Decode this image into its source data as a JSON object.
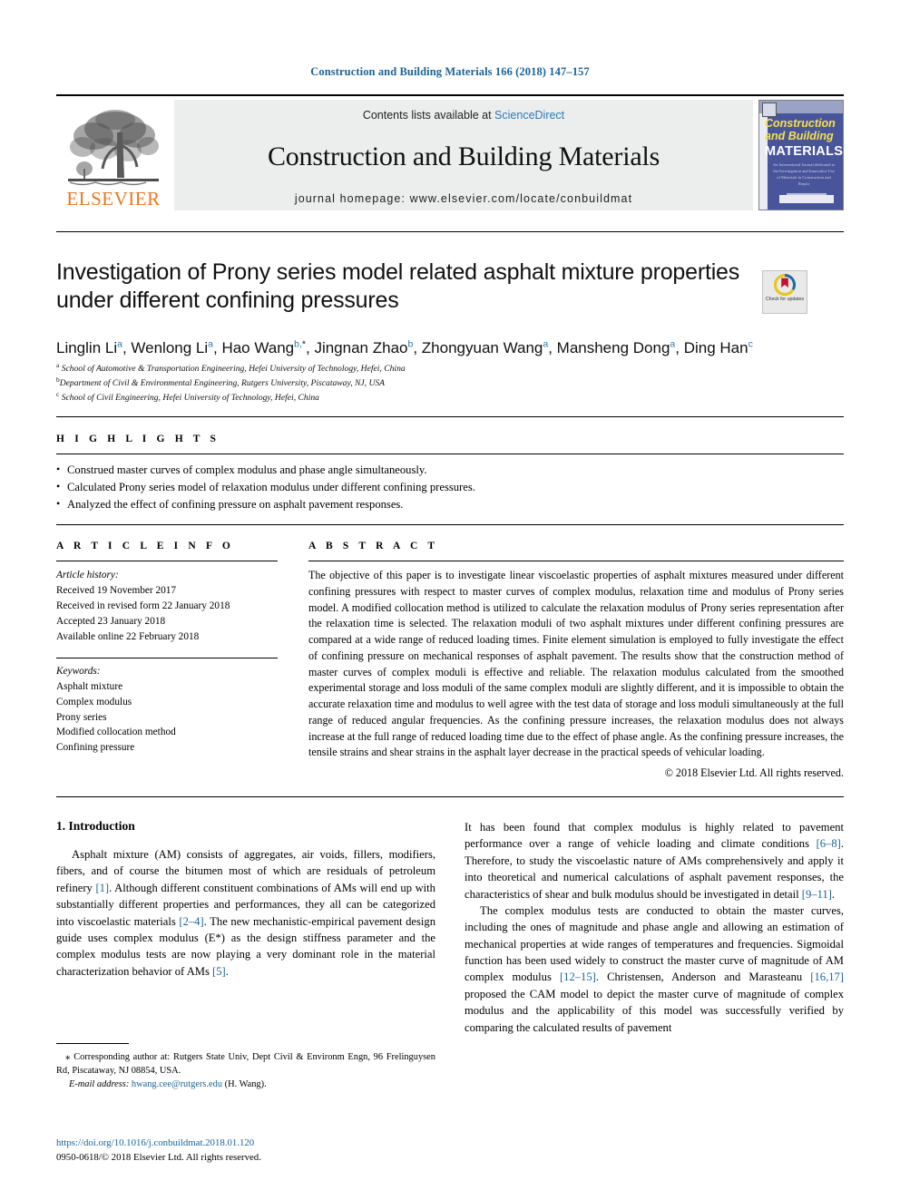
{
  "running_head": "Construction and Building Materials 166 (2018) 147–157",
  "masthead": {
    "contents_prefix": "Contents lists available at ",
    "contents_link": "ScienceDirect",
    "journal_name": "Construction and Building Materials",
    "homepage": "journal homepage: www.elsevier.com/locate/conbuildmat",
    "publisher": "ELSEVIER",
    "cover": {
      "title_line1": "Construction",
      "title_line2": "and Building",
      "title_line3": "MATERIALS",
      "subtitle": "An International Journal dedicated to the Investigation and Innovative Use of Materials in Construction and Repair"
    }
  },
  "article": {
    "title": "Investigation of Prony series model related asphalt mixture properties under different confining pressures",
    "crossmark_label": "Check for updates",
    "authors": [
      {
        "name": "Linglin Li",
        "sup": "a",
        "sep": ", "
      },
      {
        "name": "Wenlong Li",
        "sup": "a",
        "sep": ", "
      },
      {
        "name": "Hao Wang",
        "sup": "b,",
        "star": "*",
        "sep": ", "
      },
      {
        "name": "Jingnan Zhao",
        "sup": "b",
        "sep": ", "
      },
      {
        "name": "Zhongyuan Wang",
        "sup": "a",
        "sep": ", "
      },
      {
        "name": "Mansheng Dong",
        "sup": "a",
        "sep": ", "
      },
      {
        "name": "Ding Han",
        "sup": "c",
        "sep": ""
      }
    ],
    "affiliations": [
      {
        "mark": "a",
        "text": "School of Automotive & Transportation Engineering, Hefei University of Technology, Hefei, China"
      },
      {
        "mark": "b",
        "text": "Department of Civil & Environmental Engineering, Rutgers University, Piscataway, NJ, USA"
      },
      {
        "mark": "c",
        "text": "School of Civil Engineering, Hefei University of Technology, Hefei, China"
      }
    ]
  },
  "highlights": {
    "heading": "H I G H L I G H T S",
    "items": [
      "Construed master curves of complex modulus and phase angle simultaneously.",
      "Calculated Prony series model of relaxation modulus under different confining pressures.",
      "Analyzed the effect of confining pressure on asphalt pavement responses."
    ]
  },
  "article_info": {
    "heading": "A R T I C L E   I N F O",
    "history_label": "Article history:",
    "history": [
      "Received 19 November 2017",
      "Received in revised form 22 January 2018",
      "Accepted 23 January 2018",
      "Available online 22 February 2018"
    ],
    "keywords_label": "Keywords:",
    "keywords": [
      "Asphalt mixture",
      "Complex modulus",
      "Prony series",
      "Modified collocation method",
      "Confining pressure"
    ]
  },
  "abstract": {
    "heading": "A B S T R A C T",
    "text": "The objective of this paper is to investigate linear viscoelastic properties of asphalt mixtures measured under different confining pressures with respect to master curves of complex modulus, relaxation time and modulus of Prony series model. A modified collocation method is utilized to calculate the relaxation modulus of Prony series representation after the relaxation time is selected. The relaxation moduli of two asphalt mixtures under different confining pressures are compared at a wide range of reduced loading times. Finite element simulation is employed to fully investigate the effect of confining pressure on mechanical responses of asphalt pavement. The results show that the construction method of master curves of complex moduli is effective and reliable. The relaxation modulus calculated from the smoothed experimental storage and loss moduli of the same complex moduli are slightly different, and it is impossible to obtain the accurate relaxation time and modulus to well agree with the test data of storage and loss moduli simultaneously at the full range of reduced angular frequencies. As the confining pressure increases, the relaxation modulus does not always increase at the full range of reduced loading time due to the effect of phase angle. As the confining pressure increases, the tensile strains and shear strains in the asphalt layer decrease in the practical speeds of vehicular loading.",
    "copyright": "© 2018 Elsevier Ltd. All rights reserved."
  },
  "body": {
    "section_heading": "1. Introduction",
    "left_paragraph_1_a": "Asphalt mixture (AM) consists of aggregates, air voids, fillers, modifiers, fibers, and of course the bitumen most of which are residuals of petroleum refinery ",
    "left_ref_1": "[1]",
    "left_paragraph_1_b": ". Although different constituent combinations of AMs will end up with substantially different properties and performances, they all can be categorized into viscoelastic materials ",
    "left_ref_2": "[2–4]",
    "left_paragraph_1_c": ". The new mechanistic-empirical pavement design guide uses complex modulus (E*) as the design stiffness parameter and the complex modulus tests are now playing a very dominant role in the material characterization behavior of AMs ",
    "left_ref_3": "[5]",
    "left_paragraph_1_d": ".",
    "right_paragraph_1_a": "It has been found that complex modulus is highly related to pavement performance over a range of vehicle loading and climate conditions ",
    "right_ref_1": "[6–8]",
    "right_paragraph_1_b": ". Therefore, to study the viscoelastic nature of AMs comprehensively and apply it into theoretical and numerical calculations of asphalt pavement responses, the characteristics of shear and bulk modulus should be investigated in detail ",
    "right_ref_2": "[9–11]",
    "right_paragraph_1_c": ".",
    "right_paragraph_2_a": "The complex modulus tests are conducted to obtain the master curves, including the ones of magnitude and phase angle and allowing an estimation of mechanical properties at wide ranges of temperatures and frequencies. Sigmoidal function has been used widely to construct the master curve of magnitude of AM complex modulus ",
    "right_ref_3": "[12–15]",
    "right_paragraph_2_b": ". Christensen, Anderson and Marasteanu ",
    "right_ref_4": "[16,17]",
    "right_paragraph_2_c": " proposed the CAM model to depict the master curve of magnitude of complex modulus and the applicability of this model was successfully verified by comparing the calculated results of pavement"
  },
  "footnote": {
    "star": "⁎",
    "corresponding": " Corresponding author at: Rutgers State Univ, Dept Civil & Environm Engn, 96 Frelinguysen Rd, Piscataway, NJ 08854, USA.",
    "email_label": "E-mail address:",
    "email": "hwang.cee@rutgers.edu",
    "email_owner": "(H. Wang)."
  },
  "doi": {
    "url": "https://doi.org/10.1016/j.conbuildmat.2018.01.120",
    "issn": "0950-0618/© 2018 Elsevier Ltd. All rights reserved."
  },
  "colors": {
    "link": "#1a6496",
    "elsevier_orange": "#E87722",
    "cover_blue": "#49559b",
    "sciencedirect": "#2b7bb9"
  }
}
